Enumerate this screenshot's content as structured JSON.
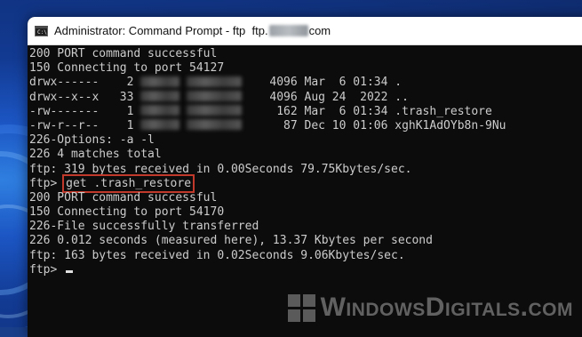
{
  "window": {
    "title_prefix": "Administrator: Command Prompt - ftp  ftp.",
    "title_suffix": "com",
    "icon_label": "C:\\"
  },
  "console": {
    "lines": [
      {
        "text": "200 PORT command successful"
      },
      {
        "text": "150 Connecting to port 54127"
      },
      {
        "parts": [
          "drwx------    2 ",
          "BLUR44",
          " ",
          "BLUR62",
          "    4096 Mar  6 01:34 ."
        ]
      },
      {
        "parts": [
          "drwx--x--x   33 ",
          "BLUR44",
          " ",
          "BLUR62",
          "    4096 Aug 24  2022 .."
        ]
      },
      {
        "parts": [
          "-rw-------    1 ",
          "BLUR44",
          " ",
          "BLUR62",
          "     162 Mar  6 01:34 .trash_restore"
        ]
      },
      {
        "parts": [
          "-rw-r--r--    1 ",
          "BLUR44",
          " ",
          "BLUR62",
          "      87 Dec 10 01:06 xghK1AdOYb8n-9Nu"
        ]
      },
      {
        "text": "226-Options: -a -l"
      },
      {
        "text": "226 4 matches total"
      },
      {
        "text": "ftp: 319 bytes received in 0.00Seconds 79.75Kbytes/sec."
      },
      {
        "prompt": "ftp> ",
        "command": "get .trash_restore",
        "highlight": true
      },
      {
        "text": "200 PORT command successful"
      },
      {
        "text": "150 Connecting to port 54170"
      },
      {
        "text": "226-File successfully transferred"
      },
      {
        "text": "226 0.012 seconds (measured here), 13.37 Kbytes per second"
      },
      {
        "text": "ftp: 163 bytes received in 0.02Seconds 9.06Kbytes/sec."
      },
      {
        "prompt": "ftp> ",
        "cursor": true
      }
    ]
  },
  "watermark": {
    "text": "WindowsDigitals.com"
  }
}
